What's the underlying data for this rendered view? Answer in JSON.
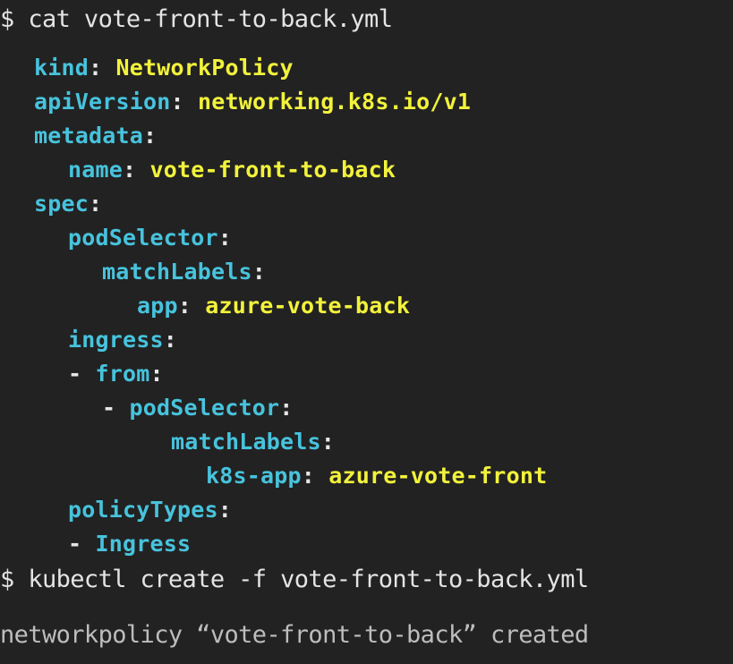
{
  "commands": {
    "cat": {
      "prompt": "$",
      "text": "cat vote-front-to-back.yml"
    },
    "kubectl": {
      "prompt": "$",
      "text": "kubectl create -f vote-front-to-back.yml"
    }
  },
  "yaml": {
    "kind": {
      "key": "kind",
      "sep": ":",
      "value": "NetworkPolicy"
    },
    "apiVersion": {
      "key": "apiVersion",
      "sep": ":",
      "value": "networking.k8s.io/v1"
    },
    "metadata": {
      "key": "metadata",
      "sep": ":"
    },
    "name": {
      "key": "name",
      "sep": ":",
      "value": "vote-front-to-back"
    },
    "spec": {
      "key": "spec",
      "sep": ":"
    },
    "podSelector": {
      "key": "podSelector",
      "sep": ":"
    },
    "matchLabels": {
      "key": "matchLabels",
      "sep": ":"
    },
    "app": {
      "key": "app",
      "sep": ":",
      "value": "azure-vote-back"
    },
    "ingress": {
      "key": "ingress",
      "sep": ":"
    },
    "from": {
      "dash": "-",
      "key": "from",
      "sep": ":"
    },
    "fromPodSelector": {
      "dash": "-",
      "key": "podSelector",
      "sep": ":"
    },
    "fromMatchLabels": {
      "key": "matchLabels",
      "sep": ":"
    },
    "k8sApp": {
      "key": "k8s-app",
      "sep": ":",
      "value": "azure-vote-front"
    },
    "policyTypes": {
      "key": "policyTypes",
      "sep": ":"
    },
    "ingressType": {
      "dash": "-",
      "value": "Ingress"
    }
  },
  "output": {
    "result": "networkpolicy “vote-front-to-back” created"
  },
  "colors": {
    "background": "#222222",
    "key": "#47c3dd",
    "value": "#f2f23c",
    "punctuation": "#e6e6e6",
    "command": "#e4e4e4",
    "output": "#bdbdbd"
  }
}
